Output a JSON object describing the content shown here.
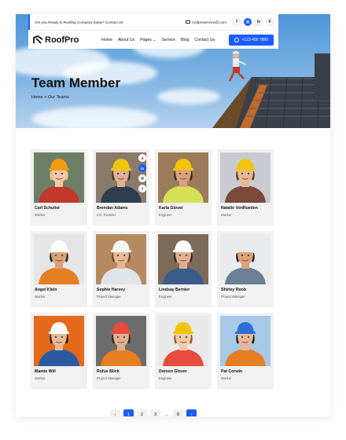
{
  "topbar": {
    "promo": "Are you Ready to Roofing Company today? Contact Us",
    "email": "roofproservice@.com",
    "social": [
      {
        "icon": "facebook-icon",
        "glyph": "f"
      },
      {
        "icon": "instagram-icon",
        "glyph": "◎"
      },
      {
        "icon": "linkedin-icon",
        "glyph": "in"
      },
      {
        "icon": "x-icon",
        "glyph": "X"
      }
    ]
  },
  "nav": {
    "logo": "RoofPro",
    "items": [
      "Home",
      "About Us",
      "Pages",
      "Service",
      "Blog",
      "Contact Us"
    ],
    "phone": "+123 456 7890"
  },
  "hero": {
    "title": "Team Member",
    "breadcrumb_home": "Home",
    "breadcrumb_sep": ">",
    "breadcrumb_current": "Our Teams"
  },
  "team": [
    {
      "name": "Carl Schulist",
      "role": "Worker",
      "bg": "#6e7f68",
      "shirt": "#c0392b",
      "helmet": "#f39c12",
      "skin": "#f2c9a8",
      "hair": "#e8c26a"
    },
    {
      "name": "Brendan Adams",
      "role": "CO. Founder",
      "bg": "#8a7a6a",
      "shirt": "#2c3e50",
      "helmet": "#f1c40f",
      "skin": "#e0b090",
      "hair": "#4a3520"
    },
    {
      "name": "Karla Glover",
      "role": "Engineer",
      "bg": "#9c7b5a",
      "shirt": "#d4e157",
      "helmet": "#f1c40f",
      "skin": "#d9a27a",
      "hair": "#3b2a1a"
    },
    {
      "name": "Natalie VonRueden",
      "role": "Worker",
      "bg": "#c8ccd0",
      "shirt": "#7b4a3a",
      "helmet": "#f1c40f",
      "skin": "#e6b896",
      "hair": "#5b3b22"
    },
    {
      "name": "Angel Klein",
      "role": "Worker",
      "bg": "#e5e5e5",
      "shirt": "#e67e22",
      "helmet": "#ffffff",
      "skin": "#d9a27a",
      "hair": "#2b1d12"
    },
    {
      "name": "Sophie Harvey",
      "role": "Project Manager",
      "bg": "#b58a60",
      "shirt": "#dfe6ea",
      "helmet": "#f5f5f5",
      "skin": "#e6b896",
      "hair": "#6b4b2a"
    },
    {
      "name": "Lindsay Bernier",
      "role": "Engineer",
      "bg": "#7c6b58",
      "shirt": "#3b5b8a",
      "helmet": "#ffffff",
      "skin": "#e0b090",
      "hair": "#3b2a1a"
    },
    {
      "name": "Shirley Roob",
      "role": "Project Manager",
      "bg": "#e9ecef",
      "shirt": "#6b7f95",
      "helmet": "#e9ecef",
      "skin": "#d9a27a",
      "hair": "#2b1d12"
    },
    {
      "name": "Mamie Will",
      "role": "Worker",
      "bg": "#e26a1a",
      "shirt": "#2c5aa0",
      "helmet": "#ffffff",
      "skin": "#e6b896",
      "hair": "#2b1d12"
    },
    {
      "name": "Rufus Blick",
      "role": "Project Manager",
      "bg": "#6c6c6c",
      "shirt": "#e67e22",
      "helmet": "#e74c3c",
      "skin": "#e0b090",
      "hair": "#3b2a1a"
    },
    {
      "name": "Doreen Glover",
      "role": "Engineer",
      "bg": "#e9e9e9",
      "shirt": "#e74c3c",
      "helmet": "#f1c40f",
      "skin": "#f2c9a8",
      "hair": "#8a5a2b"
    },
    {
      "name": "Pat Corwin",
      "role": "Worker",
      "bg": "#a7c8e6",
      "shirt": "#e67e22",
      "helmet": "#2d6fd6",
      "skin": "#e6b896",
      "hair": "#2b1d12"
    }
  ],
  "share_icons": [
    {
      "icon": "x-icon",
      "glyph": "X"
    },
    {
      "icon": "linkedin-icon",
      "glyph": "in"
    },
    {
      "icon": "instagram-icon",
      "glyph": "◎"
    },
    {
      "icon": "facebook-icon",
      "glyph": "f"
    }
  ],
  "pagination": {
    "prev": "‹",
    "pages": [
      "1",
      "2",
      "3"
    ],
    "ellipsis": "...",
    "last": "8",
    "next": "›",
    "current": "1"
  },
  "colors": {
    "accent": "#1a5cff"
  }
}
